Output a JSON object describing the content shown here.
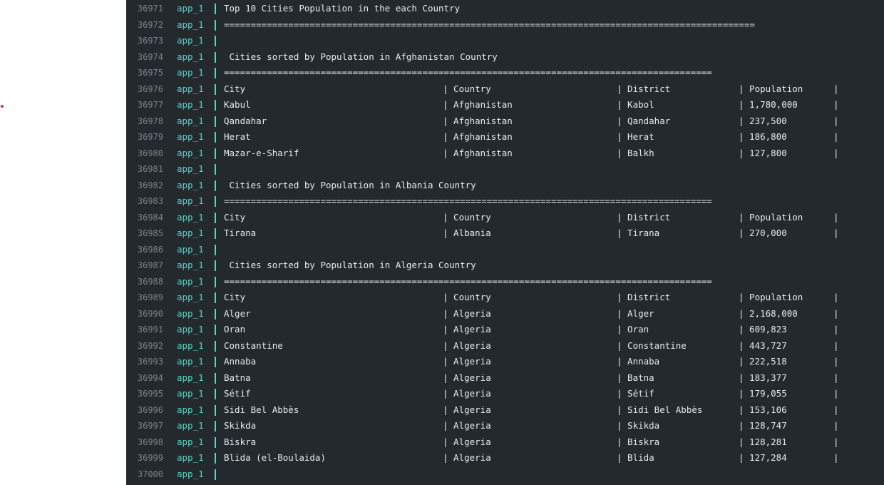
{
  "service": "app_1",
  "accent_color": "#56d4c8",
  "marker_color": "#d93025",
  "lines": [
    {
      "n": "36971",
      "type": "text",
      "text": "Top 10 Cities Population in the each Country"
    },
    {
      "n": "36972",
      "type": "text",
      "text": "==================================================================================================="
    },
    {
      "n": "36973",
      "type": "text",
      "text": ""
    },
    {
      "n": "36974",
      "type": "text",
      "text": " Cities sorted by Population in Afghanistan Country"
    },
    {
      "n": "36975",
      "type": "text",
      "text": "==========================================================================================="
    },
    {
      "n": "36976",
      "type": "row",
      "cells": [
        "City",
        "| Country",
        "| District",
        "| Population",
        "|"
      ]
    },
    {
      "n": "36977",
      "type": "row",
      "cells": [
        "Kabul",
        "| Afghanistan",
        "| Kabol",
        "| 1,780,000",
        "|"
      ]
    },
    {
      "n": "36978",
      "type": "row",
      "cells": [
        "Qandahar",
        "| Afghanistan",
        "| Qandahar",
        "| 237,500",
        "|"
      ]
    },
    {
      "n": "36979",
      "type": "row",
      "cells": [
        "Herat",
        "| Afghanistan",
        "| Herat",
        "| 186,800",
        "|"
      ]
    },
    {
      "n": "36980",
      "type": "row",
      "cells": [
        "Mazar-e-Sharif",
        "| Afghanistan",
        "| Balkh",
        "| 127,800",
        "|"
      ]
    },
    {
      "n": "36981",
      "type": "text",
      "text": ""
    },
    {
      "n": "36982",
      "type": "text",
      "text": " Cities sorted by Population in Albania Country"
    },
    {
      "n": "36983",
      "type": "text",
      "text": "==========================================================================================="
    },
    {
      "n": "36984",
      "type": "row",
      "cells": [
        "City",
        "| Country",
        "| District",
        "| Population",
        "|"
      ]
    },
    {
      "n": "36985",
      "type": "row",
      "cells": [
        "Tirana",
        "| Albania",
        "| Tirana",
        "| 270,000",
        "|"
      ]
    },
    {
      "n": "36986",
      "type": "text",
      "text": ""
    },
    {
      "n": "36987",
      "type": "text",
      "text": " Cities sorted by Population in Algeria Country"
    },
    {
      "n": "36988",
      "type": "text",
      "text": "==========================================================================================="
    },
    {
      "n": "36989",
      "type": "row",
      "cells": [
        "City",
        "| Country",
        "| District",
        "| Population",
        "|"
      ]
    },
    {
      "n": "36990",
      "type": "row",
      "cells": [
        "Alger",
        "| Algeria",
        "| Alger",
        "| 2,168,000",
        "|"
      ]
    },
    {
      "n": "36991",
      "type": "row",
      "cells": [
        "Oran",
        "| Algeria",
        "| Oran",
        "| 609,823",
        "|"
      ]
    },
    {
      "n": "36992",
      "type": "row",
      "cells": [
        "Constantine",
        "| Algeria",
        "| Constantine",
        "| 443,727",
        "|"
      ]
    },
    {
      "n": "36993",
      "type": "row",
      "cells": [
        "Annaba",
        "| Algeria",
        "| Annaba",
        "| 222,518",
        "|"
      ]
    },
    {
      "n": "36994",
      "type": "row",
      "cells": [
        "Batna",
        "| Algeria",
        "| Batna",
        "| 183,377",
        "|"
      ]
    },
    {
      "n": "36995",
      "type": "row",
      "cells": [
        "Sétif",
        "| Algeria",
        "| Sétif",
        "| 179,055",
        "|"
      ]
    },
    {
      "n": "36996",
      "type": "row",
      "cells": [
        "Sidi Bel Abbès",
        "| Algeria",
        "| Sidi Bel Abbès",
        "| 153,106",
        "|"
      ]
    },
    {
      "n": "36997",
      "type": "row",
      "cells": [
        "Skikda",
        "| Algeria",
        "| Skikda",
        "| 128,747",
        "|"
      ]
    },
    {
      "n": "36998",
      "type": "row",
      "cells": [
        "Biskra",
        "| Algeria",
        "| Biskra",
        "| 128,281",
        "|"
      ]
    },
    {
      "n": "36999",
      "type": "row",
      "cells": [
        "Blida (el-Boulaida)",
        "| Algeria",
        "| Blida",
        "| 127,284",
        "|"
      ]
    },
    {
      "n": "37000",
      "type": "text",
      "text": ""
    }
  ]
}
